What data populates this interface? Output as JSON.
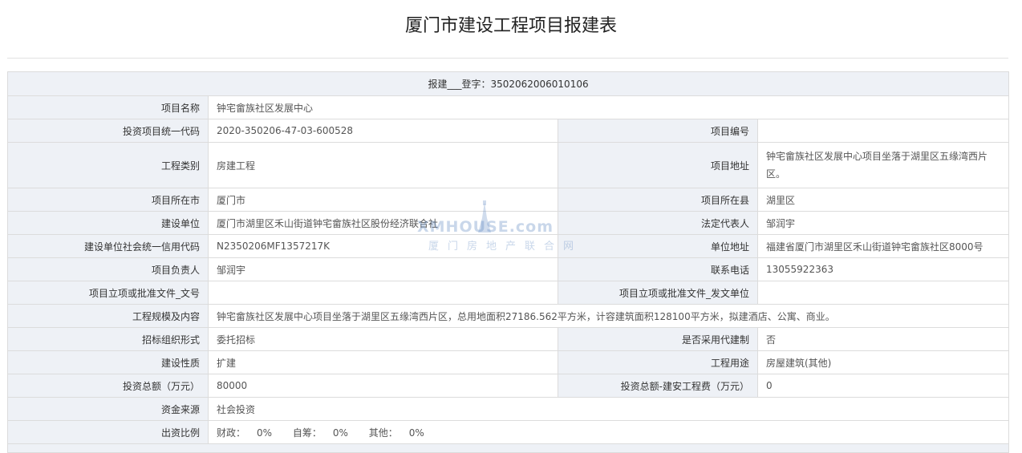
{
  "page": {
    "title": "厦门市建设工程项目报建表"
  },
  "header": {
    "registration": "报建___登字：3502062006010106"
  },
  "rows": [
    {
      "label": "项目名称",
      "value": "钟宅畲族社区发展中心"
    },
    {
      "label": "投资项目统一代码",
      "value": "2020-350206-47-03-600528",
      "label2": "项目编号",
      "value2": ""
    },
    {
      "label": "工程类别",
      "value": "房建工程",
      "label2": "项目地址",
      "value2": "钟宅畲族社区发展中心项目坐落于湖里区五缘湾西片区。"
    },
    {
      "label": "项目所在市",
      "value": "厦门市",
      "label2": "项目所在县",
      "value2": "湖里区"
    },
    {
      "label": "建设单位",
      "value": "厦门市湖里区禾山街道钟宅畲族社区股份经济联合社",
      "label2": "法定代表人",
      "value2": "邹润宇"
    },
    {
      "label": "建设单位社会统一信用代码",
      "value": "N2350206MF1357217K",
      "label2": "单位地址",
      "value2": "福建省厦门市湖里区禾山街道钟宅畲族社区8000号"
    },
    {
      "label": "项目负责人",
      "value": "邹润宇",
      "label2": "联系电话",
      "value2": "13055922363"
    },
    {
      "label": "项目立项或批准文件_文号",
      "value": "",
      "label2": "项目立项或批准文件_发文单位",
      "value2": ""
    },
    {
      "label": "工程规模及内容",
      "value": "钟宅畲族社区发展中心项目坐落于湖里区五缘湾西片区，总用地面积27186.562平方米，计容建筑面积128100平方米，拟建酒店、公寓、商业。"
    },
    {
      "label": "招标组织形式",
      "value": "委托招标",
      "label2": "是否采用代建制",
      "value2": "否"
    },
    {
      "label": "建设性质",
      "value": "扩建",
      "label2": "工程用途",
      "value2": "房屋建筑(其他)"
    },
    {
      "label": "投资总额（万元）",
      "value": "80000",
      "label2": "投资总额-建安工程费（万元）",
      "value2": "0"
    },
    {
      "label": "资金来源",
      "value": "社会投资"
    },
    {
      "label": "出资比例",
      "ratio": [
        {
          "key": "财政：",
          "val": "0%"
        },
        {
          "key": "自筹：",
          "val": "0%"
        },
        {
          "key": "其他：",
          "val": "0%"
        }
      ]
    }
  ],
  "watermark": {
    "brand": "XMHOUSE.com",
    "subtitle": "厦门房地产联合网"
  }
}
